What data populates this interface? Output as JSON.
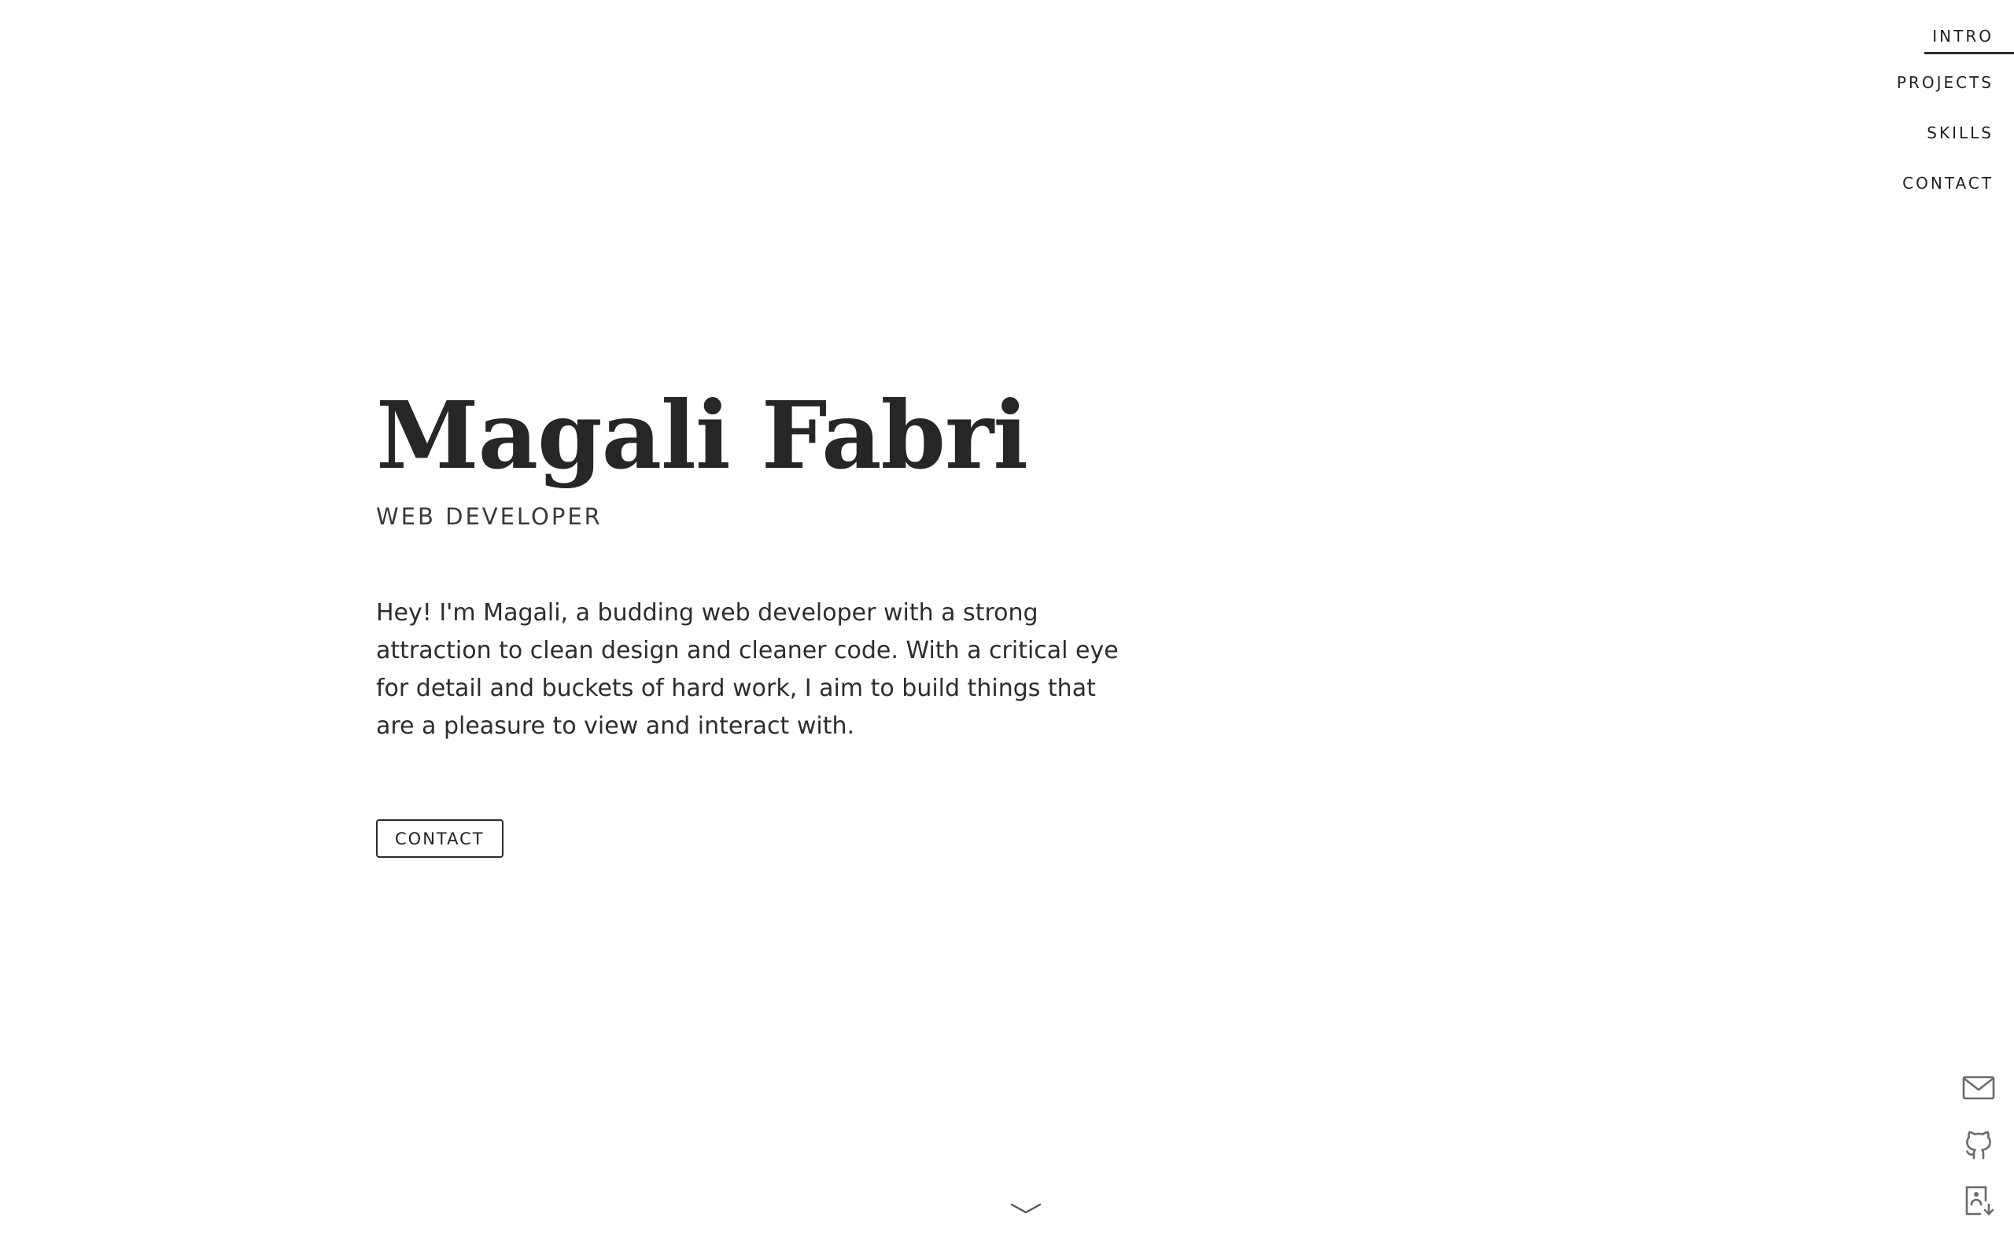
{
  "nav": {
    "items": [
      {
        "label": "INTRO",
        "active": true
      },
      {
        "label": "PROJECTS",
        "active": false
      },
      {
        "label": "SKILLS",
        "active": false
      },
      {
        "label": "CONTACT",
        "active": false
      }
    ]
  },
  "hero": {
    "name": "Magali Fabri",
    "role": "WEB DEVELOPER",
    "bio": "Hey! I'm Magali, a budding web developer with a strong attraction to clean design and cleaner code. With a critical eye for detail and buckets of hard work, I aim to build things that are a pleasure to view and interact with.",
    "contact_label": "CONTACT"
  },
  "social": {
    "icons": [
      "mail-icon",
      "github-icon",
      "resume-download-icon"
    ]
  },
  "scroll": {
    "icon": "chevron-down-icon"
  },
  "colors": {
    "text": "#2b2b2b",
    "icon": "#6b6b6b",
    "background": "#ffffff"
  }
}
